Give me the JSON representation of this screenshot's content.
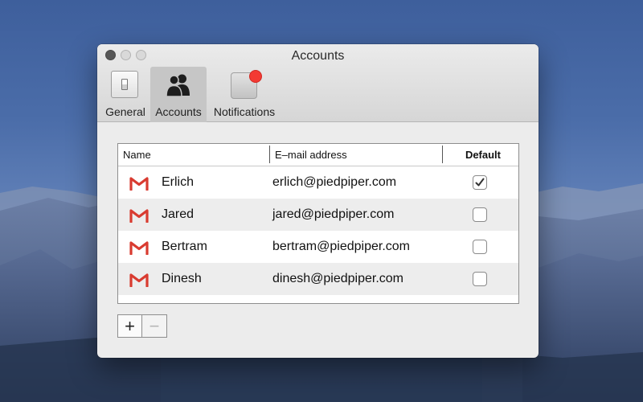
{
  "window": {
    "title": "Accounts"
  },
  "toolbar": {
    "tabs": [
      {
        "label": "General",
        "icon": "general-switch-icon",
        "selected": false
      },
      {
        "label": "Accounts",
        "icon": "accounts-people-icon",
        "selected": true
      },
      {
        "label": "Notifications",
        "icon": "notifications-icon",
        "selected": false
      }
    ]
  },
  "table": {
    "columns": [
      "Name",
      "E–mail address",
      "Default"
    ],
    "rows": [
      {
        "name": "Erlich",
        "email": "erlich@piedpiper.com",
        "default": true,
        "icon": "gmail-icon"
      },
      {
        "name": "Jared",
        "email": "jared@piedpiper.com",
        "default": false,
        "icon": "gmail-icon"
      },
      {
        "name": "Bertram",
        "email": "bertram@piedpiper.com",
        "default": false,
        "icon": "gmail-icon"
      },
      {
        "name": "Dinesh",
        "email": "dinesh@piedpiper.com",
        "default": false,
        "icon": "gmail-icon"
      }
    ]
  },
  "buttons": {
    "add_label": "+",
    "remove_label": "−"
  },
  "colors": {
    "gmail_red": "#d93b30",
    "notification_badge": "#f33a33",
    "selected_tab": "#c6c6c6"
  }
}
